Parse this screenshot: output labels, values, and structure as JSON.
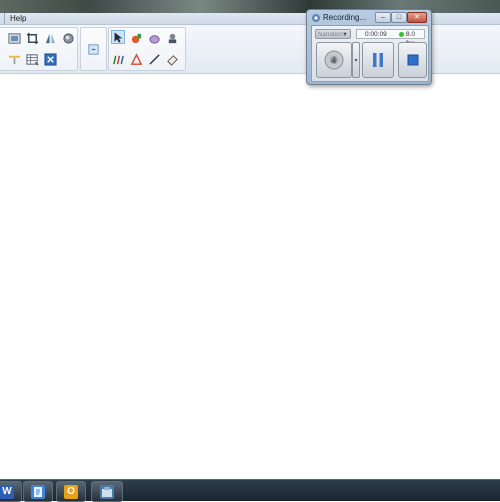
{
  "menubar": {
    "items": [
      {
        "label": "Help"
      }
    ]
  },
  "recording": {
    "title": "Recording...",
    "dropdown_value": "Narration",
    "elapsed": "0:00:09",
    "fps": "8.0 fps",
    "window_controls": [
      "minimize",
      "maximize",
      "close"
    ],
    "buttons": [
      "record",
      "pause",
      "stop"
    ]
  },
  "taskbar": {
    "apps": [
      {
        "name": "Word",
        "glyph": "W",
        "color": "#2b5fb4"
      },
      {
        "name": "Notes",
        "glyph": "",
        "color": "#3b86d8"
      },
      {
        "name": "Outlook",
        "glyph": "O",
        "color": "#e7a318"
      },
      {
        "name": "Application",
        "glyph": "",
        "color": "#4c7aa8"
      }
    ]
  },
  "colors": {
    "status_dot": "#36c12b",
    "toolbar_bg": "#e3e9f1",
    "dialog_frame": "#9fb6cf"
  }
}
